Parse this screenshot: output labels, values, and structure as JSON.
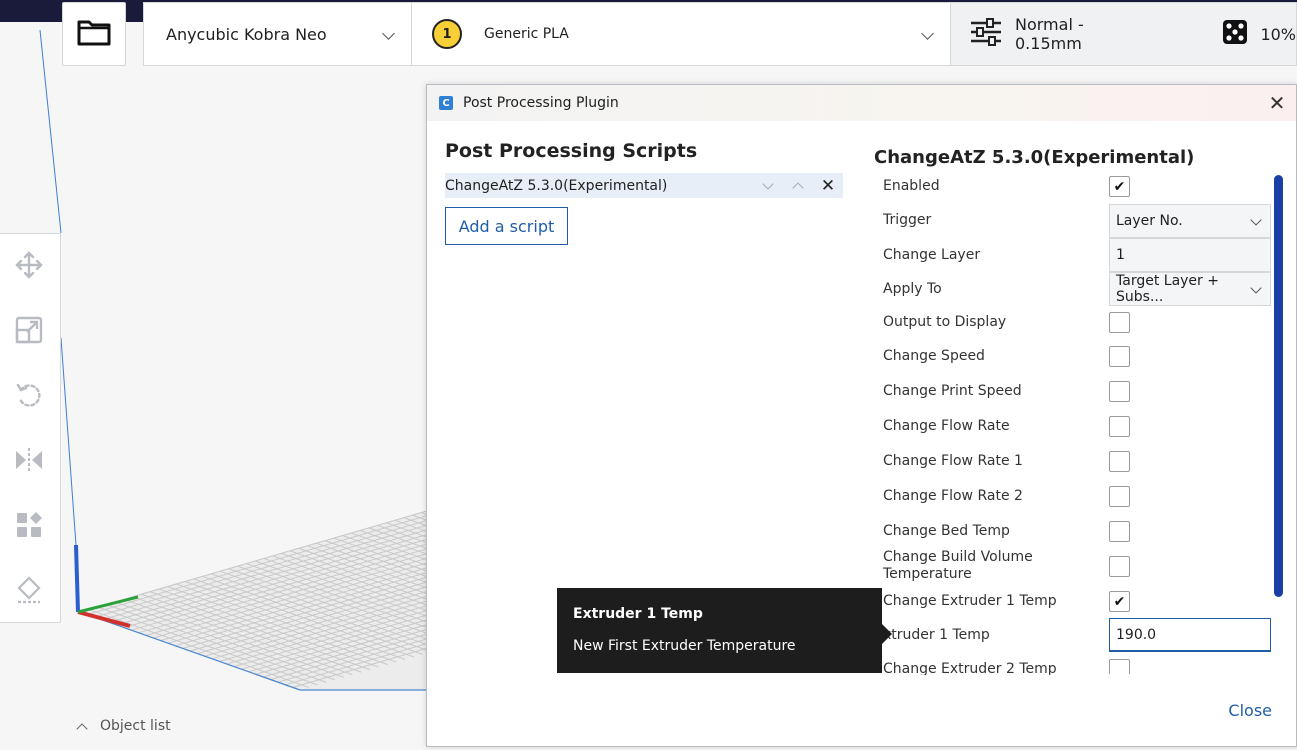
{
  "header": {
    "printer": "Anycubic Kobra Neo",
    "material_badge": "1",
    "material": "Generic PLA",
    "profile": "Normal - 0.15mm",
    "infill": "10%"
  },
  "viewport": {
    "object_list_label": "Object list"
  },
  "dialog": {
    "title": "Post Processing Plugin",
    "app_icon_letter": "C",
    "close_x": "✕",
    "scripts_heading": "Post Processing Scripts",
    "script_item": "ChangeAtZ 5.3.0(Experimental)",
    "add_script_label": "Add a script",
    "settings_title": "ChangeAtZ 5.3.0(Experimental)",
    "settings": [
      {
        "label": "Enabled",
        "type": "checkbox",
        "checked": true
      },
      {
        "label": "Trigger",
        "type": "select",
        "value": "Layer No."
      },
      {
        "label": "Change Layer",
        "type": "text",
        "value": "1"
      },
      {
        "label": "Apply To",
        "type": "select",
        "value": "Target Layer + Subs..."
      },
      {
        "label": "Output to Display",
        "type": "checkbox",
        "checked": false
      },
      {
        "label": "Change Speed",
        "type": "checkbox",
        "checked": false
      },
      {
        "label": "Change Print Speed",
        "type": "checkbox",
        "checked": false
      },
      {
        "label": "Change Flow Rate",
        "type": "checkbox",
        "checked": false
      },
      {
        "label": "Change Flow Rate 1",
        "type": "checkbox",
        "checked": false
      },
      {
        "label": "Change Flow Rate 2",
        "type": "checkbox",
        "checked": false
      },
      {
        "label": "Change Bed Temp",
        "type": "checkbox",
        "checked": false
      },
      {
        "label": "Change Build Volume Temperature",
        "type": "checkbox",
        "checked": false
      },
      {
        "label": "Change Extruder 1 Temp",
        "type": "checkbox",
        "checked": true
      },
      {
        "label": "xtruder 1 Temp",
        "type": "text",
        "value": "190.0",
        "active": true
      },
      {
        "label": "Change Extruder 2 Temp",
        "type": "checkbox",
        "checked": false
      }
    ],
    "check_glyph": "✔",
    "close_button": "Close"
  },
  "tooltip": {
    "title": "Extruder 1 Temp",
    "description": "New First Extruder Temperature"
  },
  "icons": [
    "folder-icon",
    "profile-sliders-icon",
    "infill-icon",
    "move-icon",
    "scale-icon",
    "rotate-icon",
    "mirror-icon",
    "per-model-settings-icon",
    "support-blocker-icon"
  ]
}
